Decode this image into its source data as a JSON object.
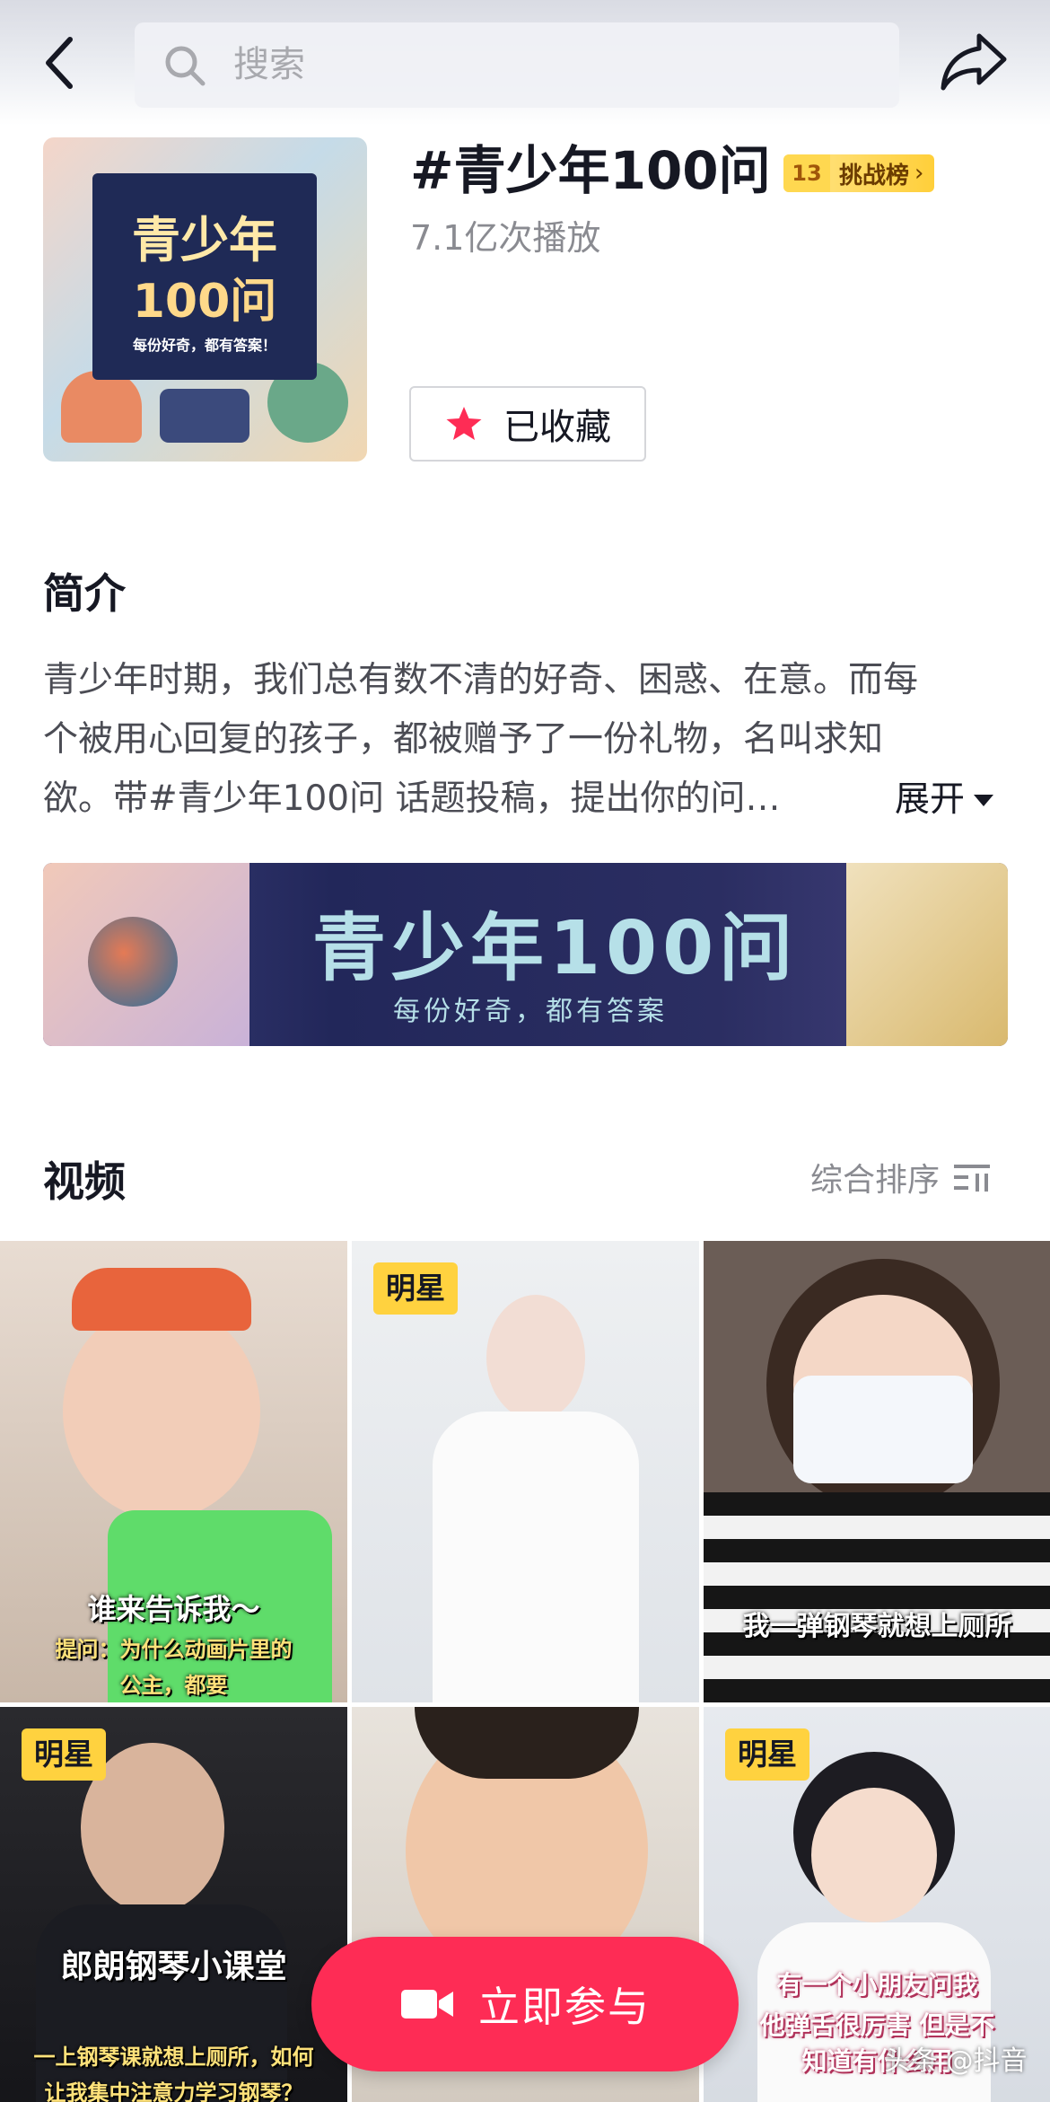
{
  "header": {
    "search_placeholder": "搜索"
  },
  "topic": {
    "title": "#青少年100问",
    "rank_number": "13",
    "rank_label": "挑战榜",
    "play_count": "7.1亿次播放",
    "collect_label": "已收藏",
    "cover": {
      "line1": "青少年",
      "line2": "100问",
      "line3": "每份好奇，都有答案！"
    }
  },
  "intro": {
    "heading": "简介",
    "lines": [
      "青少年时期，我们总有数不清的好奇、困惑、在意。而每",
      "个被用心回复的孩子，都被赠予了一份礼物，名叫求知",
      "欲。带#青少年100问 话题投稿，提出你的问…"
    ],
    "expand_label": "展开"
  },
  "banner": {
    "title": "青少年100问",
    "subtitle": "每份好奇，都有答案"
  },
  "videos": {
    "heading": "视频",
    "sort_label": "综合排序",
    "items": [
      {
        "tag": "",
        "caption": "谁来告诉我～",
        "caption2": "提问：为什么动画片里的公主，都要"
      },
      {
        "tag": "明星",
        "caption": "",
        "caption2": ""
      },
      {
        "tag": "",
        "caption": "我一弹钢琴就想上厕所",
        "caption2": ""
      },
      {
        "tag": "明星",
        "caption": "郎朗钢琴小课堂",
        "caption2": "一上钢琴课就想上厕所，如何让我集中注意力学习钢琴？"
      },
      {
        "tag": "",
        "caption": "",
        "caption2": ""
      },
      {
        "tag": "明星",
        "caption": "有一个小朋友问我",
        "caption2": "他弹舌很厉害 但是不知道有什么用"
      }
    ]
  },
  "join_button": {
    "label": "立即参与"
  },
  "watermark": "头条 @抖音",
  "colors": {
    "accent": "#fe2c55",
    "tag_bg": "#ffd23f",
    "text_primary": "#161823",
    "text_secondary": "#8a8b91"
  },
  "icons": [
    "back-icon",
    "search-icon",
    "share-icon",
    "star-icon",
    "chevron-down-icon",
    "sort-icon",
    "video-camera-icon"
  ]
}
